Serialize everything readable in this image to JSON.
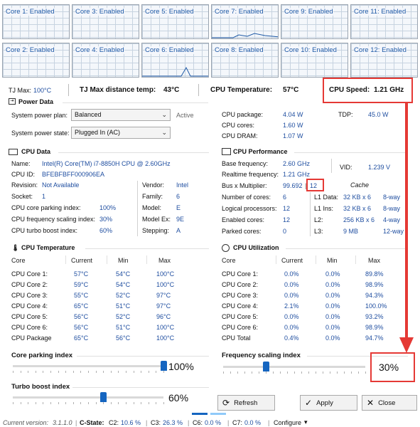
{
  "cores": [
    {
      "label": "Core 1: Enabled"
    },
    {
      "label": "Core 3: Enabled"
    },
    {
      "label": "Core 5: Enabled"
    },
    {
      "label": "Core 7: Enabled"
    },
    {
      "label": "Core 9: Enabled"
    },
    {
      "label": "Core 11: Enabled"
    },
    {
      "label": "Core 2: Enabled"
    },
    {
      "label": "Core 4: Enabled"
    },
    {
      "label": "Core 6: Enabled"
    },
    {
      "label": "Core 8: Enabled"
    },
    {
      "label": "Core 10: Enabled"
    },
    {
      "label": "Core 12: Enabled"
    }
  ],
  "status_bar": {
    "tjmax_label": "TJ Max:",
    "tjmax_value": "100°C",
    "tjdist_label": "TJ Max distance temp:",
    "tjdist_value": "43°C",
    "cputemp_label": "CPU Temperature:",
    "cputemp_value": "57°C",
    "cpuspeed_label": "CPU Speed:",
    "cpuspeed_value": "1.21 GHz"
  },
  "power": {
    "title": "Power Data",
    "plan_label": "System power plan:",
    "plan_value": "Balanced",
    "plan_state": "Active",
    "state_label": "System power state:",
    "state_value": "Plugged In (AC)",
    "pkg_label": "CPU package:",
    "pkg_value": "4.04 W",
    "cores_label": "CPU cores:",
    "cores_value": "1.60 W",
    "dram_label": "CPU DRAM:",
    "dram_value": "1.07 W",
    "tdp_label": "TDP:",
    "tdp_value": "45.0 W"
  },
  "cpu_data": {
    "title": "CPU Data",
    "name_label": "Name:",
    "name_value": "Intel(R) Core(TM) i7-8850H CPU @ 2.60GHz",
    "id_label": "CPU ID:",
    "id_value": "BFEBFBFF000906EA",
    "rev_label": "Revision:",
    "rev_value": "Not Available",
    "socket_label": "Socket:",
    "socket_value": "1",
    "park_label": "CPU core parking index:",
    "park_value": "100%",
    "freq_label": "CPU frequency scaling index:",
    "freq_value": "30%",
    "turbo_label": "CPU turbo boost index:",
    "turbo_value": "60%",
    "vendor_label": "Vendor:",
    "vendor_value": "Intel",
    "family_label": "Family:",
    "family_value": "6",
    "model_label": "Model:",
    "model_value": "E",
    "modelex_label": "Model Ex:",
    "modelex_value": "9E",
    "stepping_label": "Stepping:",
    "stepping_value": "A"
  },
  "cpu_perf": {
    "title": "CPU Performance",
    "base_label": "Base frequency:",
    "base_value": "2.60 GHz",
    "rt_label": "Realtime frequency:",
    "rt_value": "1.21 GHz",
    "bus_label": "Bus x Multiplier:",
    "bus_value": "99.692",
    "mult_value": "12",
    "ncores_label": "Number of cores:",
    "ncores_value": "6",
    "logical_label": "Logical processors:",
    "logical_value": "12",
    "enabled_label": "Enabled cores:",
    "enabled_value": "12",
    "parked_label": "Parked cores:",
    "parked_value": "0",
    "vid_label": "VID:",
    "vid_value": "1.239 V",
    "cache_title": "Cache",
    "l1d_label": "L1 Data:",
    "l1d_value": "32 KB x 6",
    "l1d_way": "8-way",
    "l1i_label": "L1 Ins:",
    "l1i_value": "32 KB x 6",
    "l1i_way": "8-way",
    "l2_label": "L2:",
    "l2_value": "256 KB x 6",
    "l2_way": "4-way",
    "l3_label": "L3:",
    "l3_value": "9 MB",
    "l3_way": "12-way"
  },
  "cpu_temp": {
    "title": "CPU Temperature",
    "headers": [
      "Core",
      "Current",
      "Min",
      "Max"
    ],
    "rows": [
      [
        "CPU Core 1:",
        "57°C",
        "54°C",
        "100°C"
      ],
      [
        "CPU Core 2:",
        "59°C",
        "54°C",
        "100°C"
      ],
      [
        "CPU Core 3:",
        "55°C",
        "52°C",
        "97°C"
      ],
      [
        "CPU Core 4:",
        "65°C",
        "51°C",
        "97°C"
      ],
      [
        "CPU Core 5:",
        "56°C",
        "52°C",
        "96°C"
      ],
      [
        "CPU Core 6:",
        "56°C",
        "51°C",
        "100°C"
      ],
      [
        "CPU Package",
        "65°C",
        "56°C",
        "100°C"
      ]
    ]
  },
  "cpu_util": {
    "title": "CPU Utilization",
    "headers": [
      "Core",
      "Current",
      "Min",
      "Max"
    ],
    "rows": [
      [
        "CPU Core 1:",
        "0.0%",
        "0.0%",
        "89.8%"
      ],
      [
        "CPU Core 2:",
        "0.0%",
        "0.0%",
        "98.9%"
      ],
      [
        "CPU Core 3:",
        "0.0%",
        "0.0%",
        "94.3%"
      ],
      [
        "CPU Core 4:",
        "2.1%",
        "0.0%",
        "100.0%"
      ],
      [
        "CPU Core 5:",
        "0.0%",
        "0.0%",
        "93.2%"
      ],
      [
        "CPU Core 6:",
        "0.0%",
        "0.0%",
        "98.9%"
      ],
      [
        "CPU Total",
        "0.4%",
        "0.0%",
        "94.7%"
      ]
    ]
  },
  "sliders": {
    "parking_label": "Core parking index",
    "parking_value": "100%",
    "parking_level": 1.0,
    "turbo_label": "Turbo boost index",
    "turbo_value": "60%",
    "turbo_level": 0.6,
    "freq_label": "Frequency scaling index",
    "freq_value": "30%",
    "freq_level": 0.3
  },
  "buttons": {
    "refresh": "Refresh",
    "apply": "Apply",
    "close": "Close"
  },
  "footer": {
    "version_label": "Current version:",
    "version_value": "3.1.1.0",
    "cstate_label": "C-State:",
    "c2_label": "C2:",
    "c2_value": "10.6 %",
    "c3_label": "C3:",
    "c3_value": "26.3 %",
    "c6_label": "C6:",
    "c6_value": "0.0 %",
    "c7_label": "C7:",
    "c7_value": "0.0 %",
    "configure": "Configure"
  },
  "colors": {
    "accent": "#1565c0",
    "value_blue": "#1f4ea0",
    "annotation_red": "#e53935"
  }
}
